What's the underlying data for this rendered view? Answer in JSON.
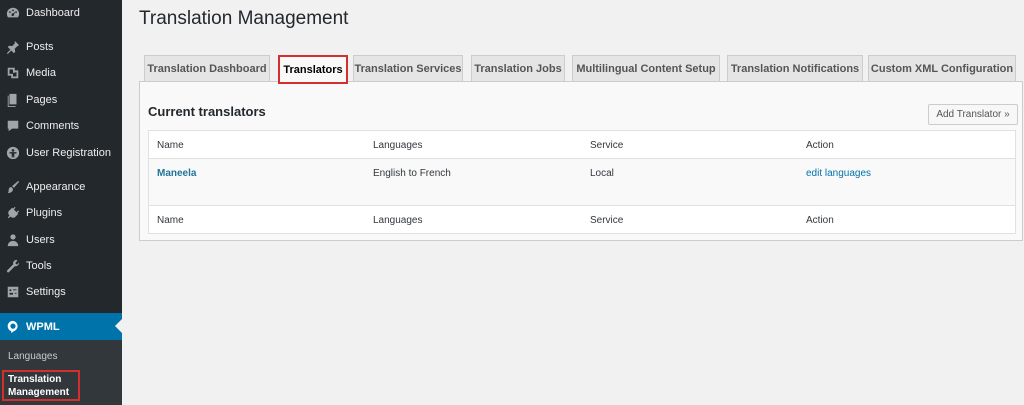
{
  "sidebar": {
    "items": [
      {
        "label": "Dashboard",
        "icon": "dashboard-icon"
      },
      {
        "label": "Posts",
        "icon": "pin-icon"
      },
      {
        "label": "Media",
        "icon": "media-icon"
      },
      {
        "label": "Pages",
        "icon": "pages-icon"
      },
      {
        "label": "Comments",
        "icon": "comment-icon"
      },
      {
        "label": "User Registration",
        "icon": "user-registration-icon"
      },
      {
        "label": "Appearance",
        "icon": "brush-icon"
      },
      {
        "label": "Plugins",
        "icon": "plugin-icon"
      },
      {
        "label": "Users",
        "icon": "users-icon"
      },
      {
        "label": "Tools",
        "icon": "wrench-icon"
      },
      {
        "label": "Settings",
        "icon": "settings-icon"
      }
    ],
    "active_item": {
      "label": "WPML",
      "icon": "wpml-icon"
    },
    "submenu": [
      {
        "label": "Languages"
      },
      {
        "label": "Translation Management"
      }
    ]
  },
  "page": {
    "title": "Translation Management"
  },
  "tabs": [
    {
      "label": "Translation Dashboard"
    },
    {
      "label": "Translators"
    },
    {
      "label": "Translation Services"
    },
    {
      "label": "Translation Jobs"
    },
    {
      "label": "Multilingual Content Setup"
    },
    {
      "label": "Translation Notifications"
    },
    {
      "label": "Custom XML Configuration"
    }
  ],
  "panel": {
    "heading": "Current translators",
    "add_button": "Add Translator »",
    "columns": [
      "Name",
      "Languages",
      "Service",
      "Action"
    ],
    "rows": [
      {
        "name": "Maneela",
        "languages": "English to French",
        "service": "Local",
        "action": "edit languages"
      }
    ]
  },
  "colors": {
    "sidebar_bg": "#23282d",
    "accent": "#0073aa",
    "highlight": "#d32f2f"
  }
}
